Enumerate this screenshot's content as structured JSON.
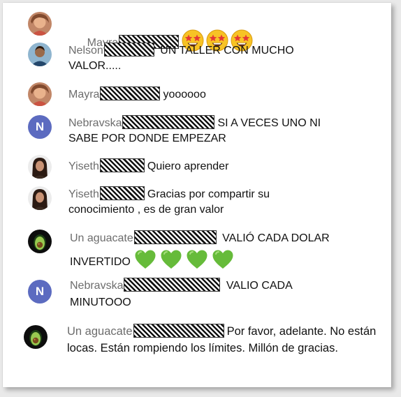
{
  "messages": [
    {
      "author": "Mayra",
      "text": "",
      "emoji": [
        "star-struck-emoji",
        "star-struck-emoji",
        "star-struck-emoji"
      ]
    },
    {
      "author": "Nelson",
      "text": " UN TALLER CON MUCHO VALOR....."
    },
    {
      "author": "Mayra",
      "text": "yoooooo"
    },
    {
      "author": "Nebravska",
      "text": "SI A VECES UNO NI SABE POR DONDE EMPEZAR",
      "avatar_letter": "N"
    },
    {
      "author": "Yiseth",
      "text": "Quiero aprender"
    },
    {
      "author": "Yiseth",
      "text": "Gracias por compartir su conocimiento , es de gran valor"
    },
    {
      "author": "Un aguacate",
      "text": " VALIÓ CADA DOLAR INVERTIDO",
      "emoji": [
        "green-heart-emoji",
        "green-heart-emoji",
        "green-heart-emoji",
        "green-heart-emoji"
      ]
    },
    {
      "author": "Nebravska",
      "text": " VALIO CADA MINUTOOO",
      "avatar_letter": "N"
    },
    {
      "author": "Un aguacate",
      "text": "Por favor, adelante. No están locas. Están rompiendo los límites. Millón de gracias."
    }
  ],
  "colors": {
    "author": "#6d6d6d",
    "text": "#111111",
    "letter_avatar": "#5c6bc0"
  }
}
